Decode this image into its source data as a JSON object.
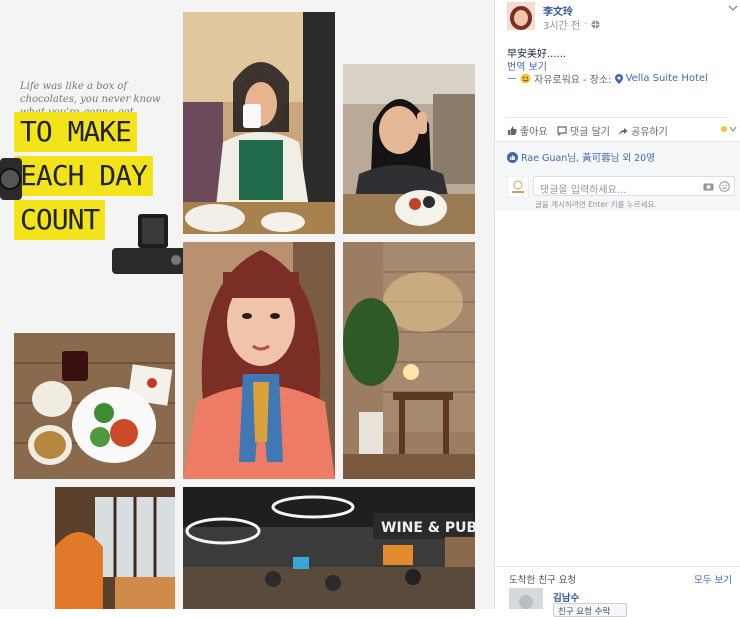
{
  "collage": {
    "quote": "Life was like a box of chocolates, you never know what you're gonna get.",
    "headline": [
      "TO MAKE",
      "EACH DAY",
      "COUNT"
    ]
  },
  "post": {
    "author": "李文玲",
    "time": "3시간 전",
    "message": "早安美好......",
    "translate": "번역 보기",
    "feeling_prefix": "—",
    "feeling": "자유로워요",
    "location_prefix": "- 장소:",
    "location": "Vella Suite Hotel"
  },
  "actions": {
    "like": "좋아요",
    "comment": "댓글 달기",
    "share": "공유하기"
  },
  "reactions": {
    "text": "Rae Guan님, 黃可蓉님 외 20명"
  },
  "comment_box": {
    "placeholder": "댓글을 입력하세요...",
    "hint": "글을 게시하려면 Enter 키를 누르세요."
  },
  "friend_requests": {
    "title": "도착한 친구 요청",
    "see_all": "모두 보기",
    "name": "김남수",
    "button": "친구 요청 수락"
  },
  "colors": {
    "link": "#4267b2",
    "highlight": "#f3e31a",
    "muted": "#90949c"
  }
}
